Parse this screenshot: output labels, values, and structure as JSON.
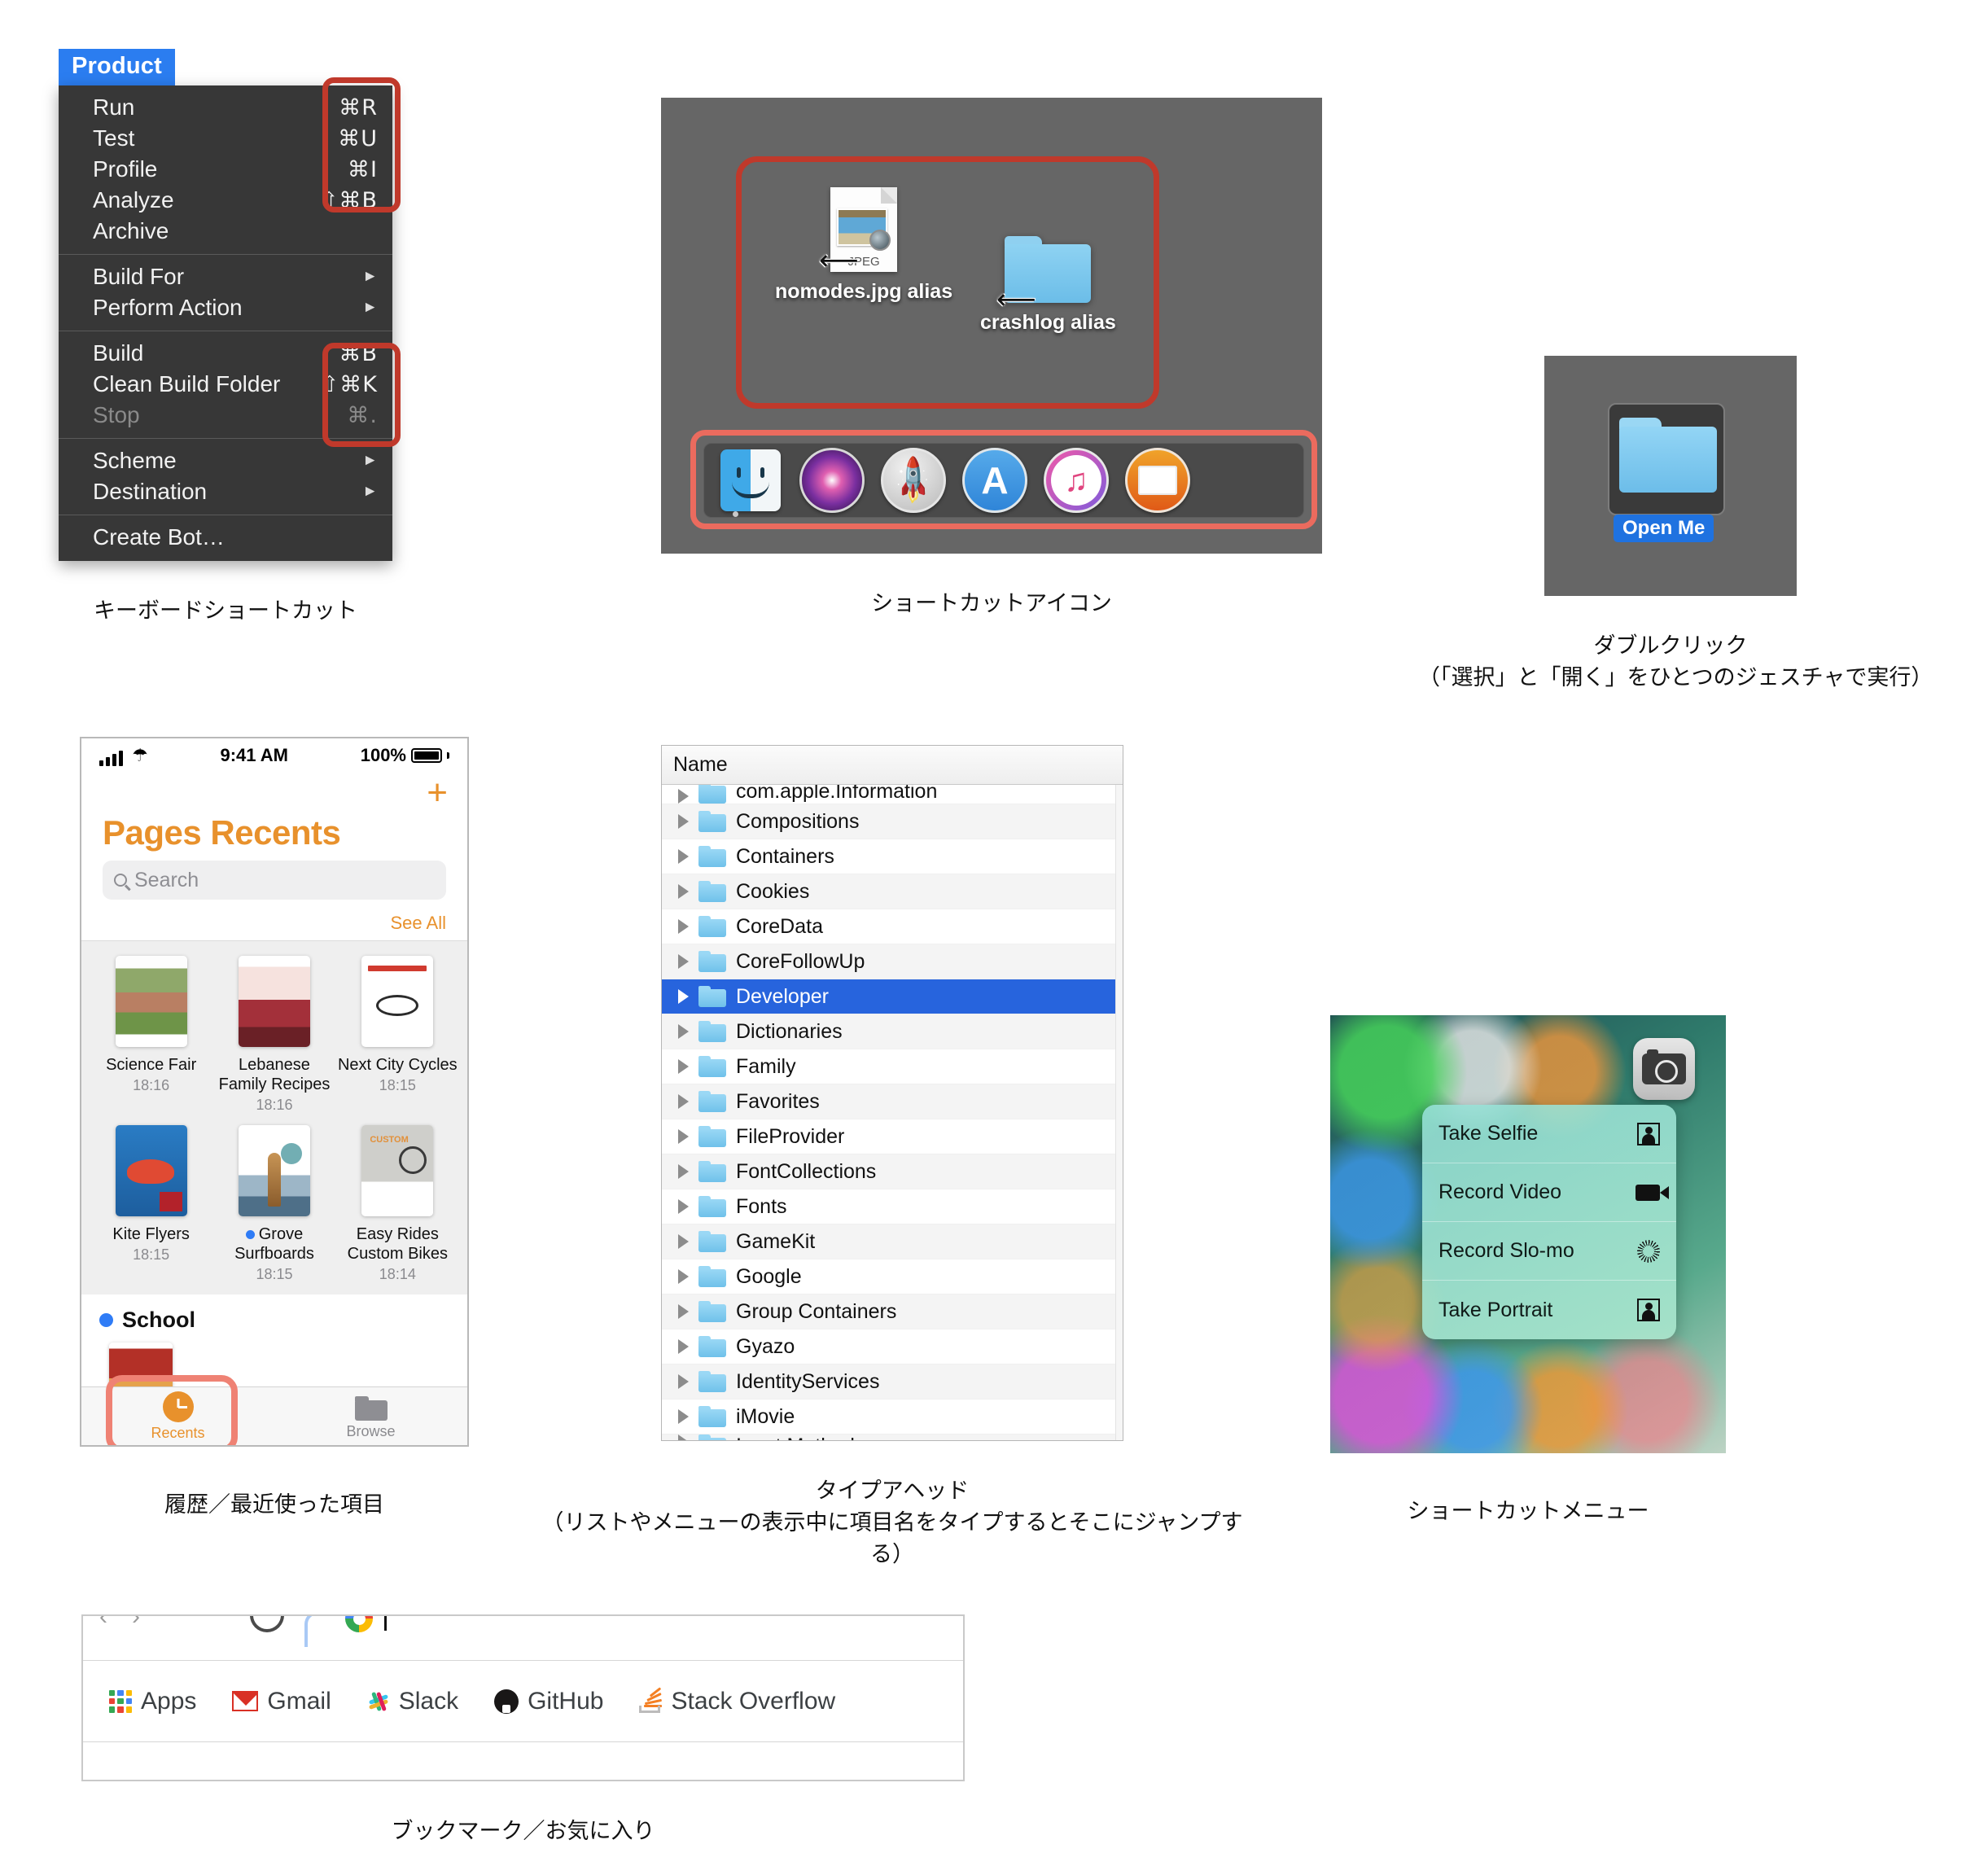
{
  "sections": {
    "keyboard_shortcut": {
      "caption": "キーボードショートカット",
      "menu_title": "Product",
      "items": [
        {
          "label": "Run",
          "shortcut": "⌘R",
          "submenu": false,
          "disabled": false
        },
        {
          "label": "Test",
          "shortcut": "⌘U",
          "submenu": false,
          "disabled": false
        },
        {
          "label": "Profile",
          "shortcut": "⌘I",
          "submenu": false,
          "disabled": false
        },
        {
          "label": "Analyze",
          "shortcut": "⇧⌘B",
          "submenu": false,
          "disabled": false
        },
        {
          "label": "Archive",
          "shortcut": "",
          "submenu": false,
          "disabled": false
        },
        {
          "label": "Build For",
          "shortcut": "",
          "submenu": true,
          "disabled": false
        },
        {
          "label": "Perform Action",
          "shortcut": "",
          "submenu": true,
          "disabled": false
        },
        {
          "label": "Build",
          "shortcut": "⌘B",
          "submenu": false,
          "disabled": false
        },
        {
          "label": "Clean Build Folder",
          "shortcut": "⇧⌘K",
          "submenu": false,
          "disabled": false
        },
        {
          "label": "Stop",
          "shortcut": "⌘.",
          "submenu": false,
          "disabled": true
        },
        {
          "label": "Scheme",
          "shortcut": "",
          "submenu": true,
          "disabled": false
        },
        {
          "label": "Destination",
          "shortcut": "",
          "submenu": true,
          "disabled": false
        },
        {
          "label": "Create Bot…",
          "shortcut": "",
          "submenu": false,
          "disabled": false
        }
      ]
    },
    "shortcut_icon": {
      "caption": "ショートカットアイコン",
      "desktop_items": [
        {
          "name": "nomodes.jpg alias",
          "kind": "jpeg-file",
          "badge": "JPEG"
        },
        {
          "name": "crashlog alias",
          "kind": "folder",
          "badge": ""
        }
      ],
      "dock_items": [
        {
          "name": "Finder"
        },
        {
          "name": "Siri"
        },
        {
          "name": "Launchpad"
        },
        {
          "name": "App Store"
        },
        {
          "name": "iTunes"
        },
        {
          "name": "Books"
        }
      ]
    },
    "double_click": {
      "caption": "ダブルクリック\n（「選択」と「開く」をひとつのジェスチャで実行）",
      "folder_label": "Open Me"
    },
    "recents": {
      "caption": "履歴／最近使った項目",
      "status": {
        "time": "9:41 AM",
        "battery": "100%"
      },
      "title": "Pages Recents",
      "add_button": "+",
      "search_placeholder": "Search",
      "see_all": "See All",
      "documents": [
        {
          "name": "Science Fair",
          "time": "18:16",
          "flagged": false
        },
        {
          "name": "Lebanese\nFamily Recipes",
          "time": "18:16",
          "flagged": false
        },
        {
          "name": "Next City\nCycles",
          "time": "18:15",
          "flagged": false
        },
        {
          "name": "Kite Flyers",
          "time": "18:15",
          "flagged": false
        },
        {
          "name": "Grove\nSurfboards",
          "time": "18:15",
          "flagged": true
        },
        {
          "name": "Easy Rides\nCustom Bikes",
          "time": "18:14",
          "flagged": false
        }
      ],
      "group_title": "School",
      "tabs": [
        {
          "label": "Recents",
          "active": true
        },
        {
          "label": "Browse",
          "active": false
        }
      ]
    },
    "typeahead": {
      "caption": "タイプアヘッド\n（リストやメニューの表示中に項目名をタイプするとそこにジャンプする）",
      "column_header": "Name",
      "clipped_top": "com.apple.Information",
      "clipped_bottom": "Input Methods",
      "rows": [
        {
          "name": "Compositions",
          "selected": false
        },
        {
          "name": "Containers",
          "selected": false
        },
        {
          "name": "Cookies",
          "selected": false
        },
        {
          "name": "CoreData",
          "selected": false
        },
        {
          "name": "CoreFollowUp",
          "selected": false
        },
        {
          "name": "Developer",
          "selected": true
        },
        {
          "name": "Dictionaries",
          "selected": false
        },
        {
          "name": "Family",
          "selected": false
        },
        {
          "name": "Favorites",
          "selected": false
        },
        {
          "name": "FileProvider",
          "selected": false
        },
        {
          "name": "FontCollections",
          "selected": false
        },
        {
          "name": "Fonts",
          "selected": false
        },
        {
          "name": "GameKit",
          "selected": false
        },
        {
          "name": "Google",
          "selected": false
        },
        {
          "name": "Group Containers",
          "selected": false
        },
        {
          "name": "Gyazo",
          "selected": false
        },
        {
          "name": "IdentityServices",
          "selected": false
        },
        {
          "name": "iMovie",
          "selected": false
        }
      ]
    },
    "shortcut_menu": {
      "caption": "ショートカットメニュー",
      "app": "Camera",
      "items": [
        {
          "label": "Take Selfie",
          "icon": "portrait-icon"
        },
        {
          "label": "Record Video",
          "icon": "video-camera-icon"
        },
        {
          "label": "Record Slo-mo",
          "icon": "slo-mo-icon"
        },
        {
          "label": "Take Portrait",
          "icon": "portrait-icon"
        }
      ]
    },
    "bookmarks": {
      "caption": "ブックマーク／お気に入り",
      "items": [
        {
          "label": "Apps",
          "icon": "apps-grid-icon"
        },
        {
          "label": "Gmail",
          "icon": "gmail-icon"
        },
        {
          "label": "Slack",
          "icon": "slack-icon"
        },
        {
          "label": "GitHub",
          "icon": "github-icon"
        },
        {
          "label": "Stack Overflow",
          "icon": "stack-overflow-icon"
        }
      ]
    }
  },
  "colors": {
    "accent_blue": "#2b7df0",
    "callout_red": "#c0392b",
    "callout_pink": "#ef8274",
    "pages_orange": "#e8912c",
    "selection_blue": "#2764dd"
  }
}
